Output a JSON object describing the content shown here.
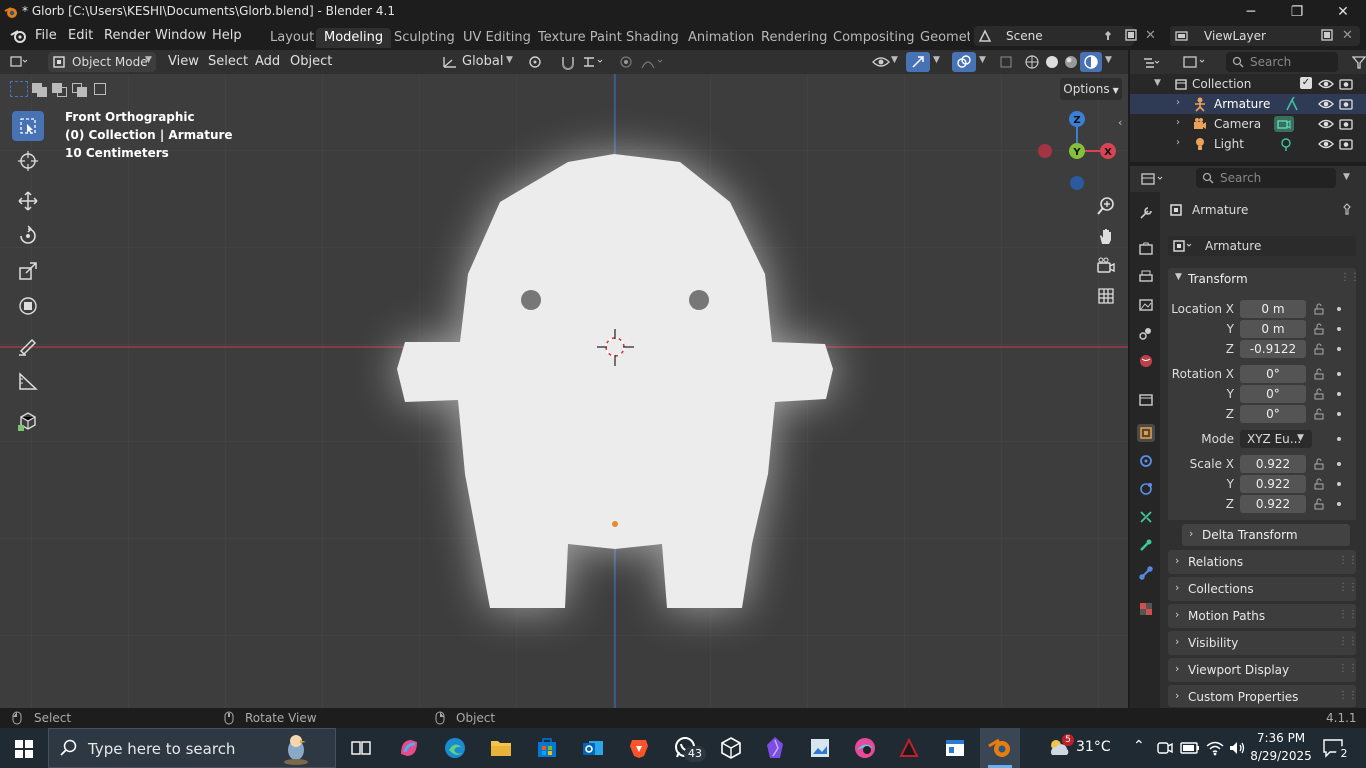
{
  "window": {
    "title": "* Glorb [C:\\Users\\KESHI\\Documents\\Glorb.blend] - Blender 4.1",
    "minimize": "─",
    "maximize": "❐",
    "close": "✕"
  },
  "menubar": {
    "menus": [
      "File",
      "Edit",
      "Render",
      "Window",
      "Help"
    ],
    "workspaces": [
      "Layout",
      "Modeling",
      "Sculpting",
      "UV Editing",
      "Texture Paint",
      "Shading",
      "Animation",
      "Rendering",
      "Compositing",
      "Geomet"
    ],
    "active_workspace": "Modeling",
    "scene": "Scene",
    "view_layer": "ViewLayer"
  },
  "viewport_header": {
    "mode": "Object Mode",
    "menus": [
      "View",
      "Select",
      "Add",
      "Object"
    ],
    "transform_orientation": "Global",
    "options": "Options"
  },
  "viewport": {
    "view_name": "Front Orthographic",
    "collection_info": "(0) Collection | Armature",
    "scale_info": "10 Centimeters",
    "gizmo": {
      "z": "Z",
      "y": "Y",
      "x": "X"
    }
  },
  "outliner": {
    "search_placeholder": "Search",
    "collection": "Collection",
    "items": [
      "Armature",
      "Camera",
      "Light"
    ]
  },
  "properties": {
    "search_placeholder": "Search",
    "object_name": "Armature",
    "datablock_name": "Armature",
    "transform_header": "Transform",
    "location_label": "Location X",
    "rotation_label": "Rotation X",
    "scale_label": "Scale X",
    "y_label": "Y",
    "z_label": "Z",
    "location": [
      "0 m",
      "0 m",
      "-0.9122"
    ],
    "rotation": [
      "0°",
      "0°",
      "0°"
    ],
    "mode_label": "Mode",
    "mode_value": "XYZ Eu...",
    "scale": [
      "0.922",
      "0.922",
      "0.922"
    ],
    "delta_transform": "Delta Transform",
    "panels": [
      "Relations",
      "Collections",
      "Motion Paths",
      "Visibility",
      "Viewport Display",
      "Custom Properties"
    ]
  },
  "statusbar": {
    "select": "Select",
    "rotate_view": "Rotate View",
    "object": "Object",
    "version": "4.1.1"
  },
  "taskbar": {
    "search_placeholder": "Type here to search",
    "whatsapp_badge": "43",
    "weather_badge": "5",
    "temperature": "31°C",
    "time": "7:36 PM",
    "date": "8/29/2025",
    "notification_count": "2"
  },
  "colors": {
    "accent": "#4772b3",
    "x_axis": "#d94455",
    "y_axis": "#85c03a",
    "z_axis": "#3b7fd6",
    "taskbar": "#1f2a33"
  }
}
